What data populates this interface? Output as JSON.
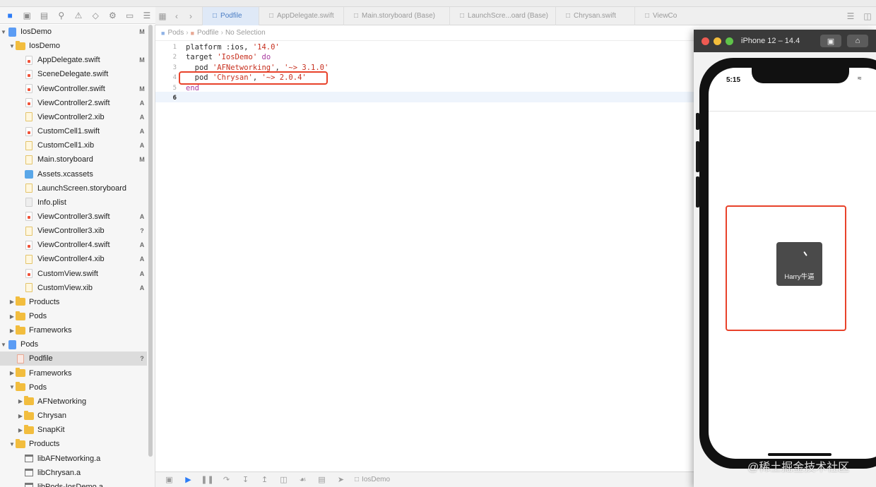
{
  "tabs": [
    {
      "label": "Podfile",
      "active": true
    },
    {
      "label": "AppDelegate.swift",
      "active": false
    },
    {
      "label": "Main.storyboard (Base)",
      "active": false
    },
    {
      "label": "LaunchScre...oard (Base)",
      "active": false
    },
    {
      "label": "Chrysan.swift",
      "active": false
    },
    {
      "label": "ViewContr",
      "active": false
    }
  ],
  "breadcrumb": [
    "Pods",
    "Podfile",
    "No Selection"
  ],
  "navigator": {
    "rows": [
      {
        "name": "IosDemo",
        "badge": "M",
        "indent": 0,
        "icon": "project",
        "disclosure": "open"
      },
      {
        "name": "IosDemo",
        "badge": "",
        "indent": 1,
        "icon": "folder",
        "disclosure": "open"
      },
      {
        "name": "AppDelegate.swift",
        "badge": "M",
        "indent": 2,
        "icon": "swift",
        "disclosure": ""
      },
      {
        "name": "SceneDelegate.swift",
        "badge": "",
        "indent": 2,
        "icon": "swift",
        "disclosure": ""
      },
      {
        "name": "ViewController.swift",
        "badge": "M",
        "indent": 2,
        "icon": "swift",
        "disclosure": ""
      },
      {
        "name": "ViewController2.swift",
        "badge": "A",
        "indent": 2,
        "icon": "swift",
        "disclosure": ""
      },
      {
        "name": "ViewController2.xib",
        "badge": "A",
        "indent": 2,
        "icon": "xib",
        "disclosure": ""
      },
      {
        "name": "CustomCell1.swift",
        "badge": "A",
        "indent": 2,
        "icon": "swift",
        "disclosure": ""
      },
      {
        "name": "CustomCell1.xib",
        "badge": "A",
        "indent": 2,
        "icon": "xib",
        "disclosure": ""
      },
      {
        "name": "Main.storyboard",
        "badge": "M",
        "indent": 2,
        "icon": "xib",
        "disclosure": ""
      },
      {
        "name": "Assets.xcassets",
        "badge": "",
        "indent": 2,
        "icon": "assets",
        "disclosure": ""
      },
      {
        "name": "LaunchScreen.storyboard",
        "badge": "",
        "indent": 2,
        "icon": "xib",
        "disclosure": ""
      },
      {
        "name": "Info.plist",
        "badge": "",
        "indent": 2,
        "icon": "plist",
        "disclosure": ""
      },
      {
        "name": "ViewController3.swift",
        "badge": "A",
        "indent": 2,
        "icon": "swift",
        "disclosure": ""
      },
      {
        "name": "ViewController3.xib",
        "badge": "?",
        "indent": 2,
        "icon": "xib",
        "disclosure": ""
      },
      {
        "name": "ViewController4.swift",
        "badge": "A",
        "indent": 2,
        "icon": "swift",
        "disclosure": ""
      },
      {
        "name": "ViewController4.xib",
        "badge": "A",
        "indent": 2,
        "icon": "xib",
        "disclosure": ""
      },
      {
        "name": "CustomView.swift",
        "badge": "A",
        "indent": 2,
        "icon": "swift",
        "disclosure": ""
      },
      {
        "name": "CustomView.xib",
        "badge": "A",
        "indent": 2,
        "icon": "xib",
        "disclosure": ""
      },
      {
        "name": "Products",
        "badge": "",
        "indent": 1,
        "icon": "folder",
        "disclosure": "closed"
      },
      {
        "name": "Pods",
        "badge": "",
        "indent": 1,
        "icon": "folder",
        "disclosure": "closed"
      },
      {
        "name": "Frameworks",
        "badge": "",
        "indent": 1,
        "icon": "folder",
        "disclosure": "closed"
      },
      {
        "name": "Pods",
        "badge": "",
        "indent": 0,
        "icon": "project",
        "disclosure": "open"
      },
      {
        "name": "Podfile",
        "badge": "?",
        "indent": 1,
        "icon": "pod",
        "disclosure": "",
        "selected": true
      },
      {
        "name": "Frameworks",
        "badge": "",
        "indent": 1,
        "icon": "folder",
        "disclosure": "closed"
      },
      {
        "name": "Pods",
        "badge": "",
        "indent": 1,
        "icon": "folder",
        "disclosure": "open"
      },
      {
        "name": "AFNetworking",
        "badge": "",
        "indent": 2,
        "icon": "folder",
        "disclosure": "closed"
      },
      {
        "name": "Chrysan",
        "badge": "",
        "indent": 2,
        "icon": "folder",
        "disclosure": "closed"
      },
      {
        "name": "SnapKit",
        "badge": "",
        "indent": 2,
        "icon": "folder",
        "disclosure": "closed"
      },
      {
        "name": "Products",
        "badge": "",
        "indent": 1,
        "icon": "folder",
        "disclosure": "open"
      },
      {
        "name": "libAFNetworking.a",
        "badge": "",
        "indent": 2,
        "icon": "lib",
        "disclosure": ""
      },
      {
        "name": "libChrysan.a",
        "badge": "",
        "indent": 2,
        "icon": "lib",
        "disclosure": ""
      },
      {
        "name": "libPods-IosDemo.a",
        "badge": "",
        "indent": 2,
        "icon": "lib",
        "disclosure": ""
      }
    ]
  },
  "editor": {
    "line_numbers": [
      "1",
      "2",
      "3",
      "4",
      "5",
      "6"
    ],
    "current_line": 6,
    "lines": [
      [
        {
          "t": "platform :ios, ",
          "c": ""
        },
        {
          "t": "'14.0'",
          "c": "str"
        }
      ],
      [
        {
          "t": "target ",
          "c": ""
        },
        {
          "t": "'IosDemo'",
          "c": "str"
        },
        {
          "t": " ",
          "c": ""
        },
        {
          "t": "do",
          "c": "kw"
        }
      ],
      [
        {
          "t": "  pod ",
          "c": ""
        },
        {
          "t": "'AFNetworking'",
          "c": "str"
        },
        {
          "t": ", ",
          "c": ""
        },
        {
          "t": "'~> 3.1.0'",
          "c": "str"
        }
      ],
      [
        {
          "t": "  pod ",
          "c": ""
        },
        {
          "t": "'Chrysan'",
          "c": "str"
        },
        {
          "t": ", ",
          "c": ""
        },
        {
          "t": "'~> 2.0.4'",
          "c": "str"
        }
      ],
      [
        {
          "t": "end",
          "c": "kw"
        }
      ],
      [
        {
          "t": "",
          "c": ""
        }
      ]
    ]
  },
  "debug_bar": {
    "scheme": "IosDemo"
  },
  "simulator": {
    "title": "iPhone 12 – 14.4",
    "status_time": "5:15",
    "hud_text": "Harry牛逼"
  },
  "watermark": "@稀土掘金技术社区",
  "colors": {
    "annotation_red": "#e8422a",
    "accent_blue": "#2d7cf6",
    "string_red": "#c7301f",
    "keyword_purple": "#a83aa0"
  }
}
